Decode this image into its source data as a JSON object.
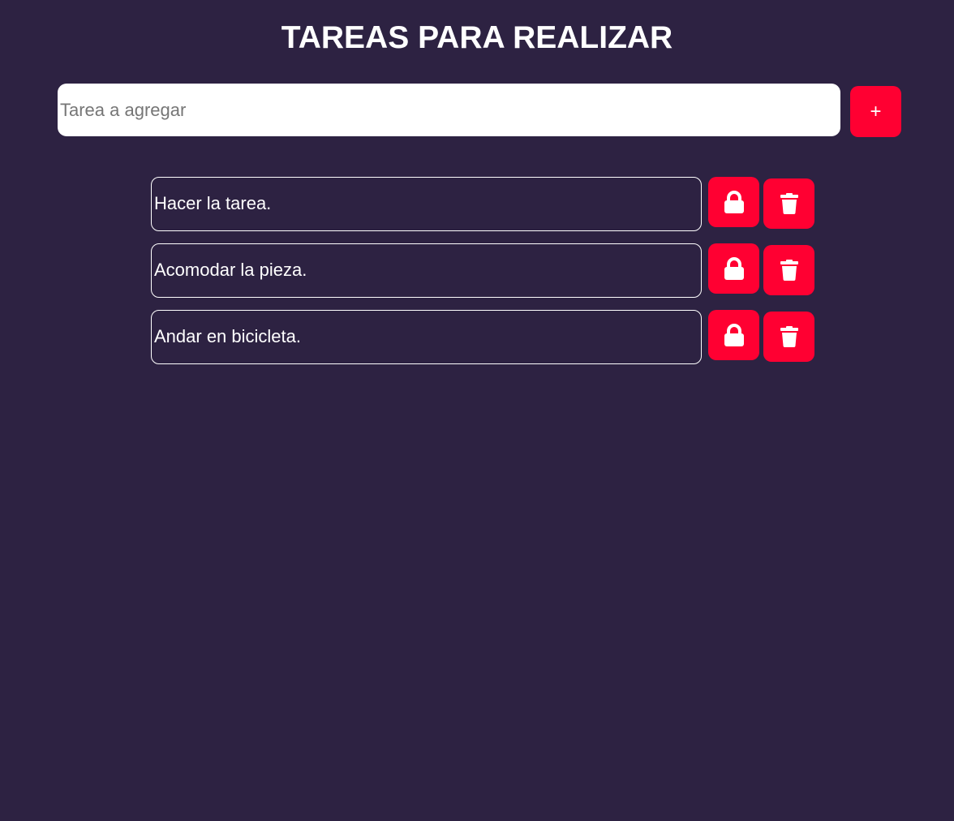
{
  "header": {
    "title": "TAREAS PARA REALIZAR"
  },
  "add_form": {
    "input_value": "",
    "input_placeholder": "Tarea a agregar",
    "add_button_label": "+"
  },
  "tasks": [
    {
      "text": "Hacer la tarea.",
      "lock_icon": "lock-icon",
      "delete_icon": "trash-icon"
    },
    {
      "text": "Acomodar la pieza.",
      "lock_icon": "lock-icon",
      "delete_icon": "trash-icon"
    },
    {
      "text": "Andar en bicicleta.",
      "lock_icon": "lock-icon",
      "delete_icon": "trash-icon"
    }
  ],
  "colors": {
    "background": "#2d2242",
    "accent": "#ff0032",
    "text": "#ffffff"
  }
}
